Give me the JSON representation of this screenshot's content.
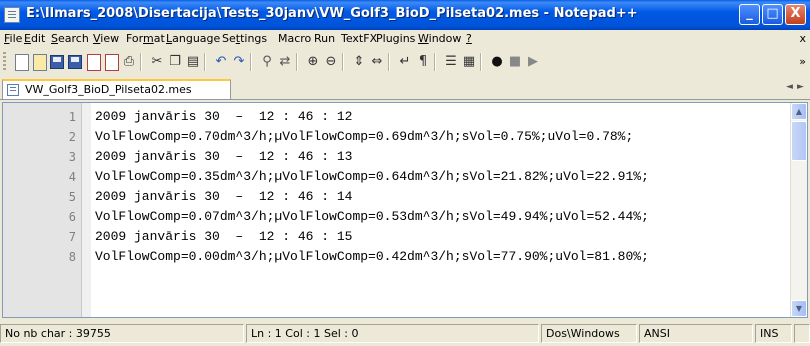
{
  "window": {
    "title": "E:\\Ilmars_2008\\Disertacija\\Tests_30janv\\VW_Golf3_BioD_Pilseta02.mes - Notepad++",
    "controls": {
      "minimize": "_",
      "maximize": "□",
      "close": "X"
    }
  },
  "menu": [
    {
      "label": "File",
      "mn": "F",
      "rest": "ile"
    },
    {
      "label": "Edit",
      "mn": "E",
      "rest": "dit"
    },
    {
      "label": "Search",
      "mn": "S",
      "rest": "earch"
    },
    {
      "label": "View",
      "mn": "V",
      "rest": "iew"
    },
    {
      "label": "Format",
      "pre": "For",
      "mn": "m",
      "rest": "at"
    },
    {
      "label": "Language",
      "mn": "L",
      "rest": "anguage"
    },
    {
      "label": "Settings",
      "pre": "Se",
      "mn": "t",
      "rest": "tings"
    },
    {
      "label": "Macro",
      "pre": "",
      "mn": "",
      "rest": "Macro"
    },
    {
      "label": "Run",
      "pre": "",
      "mn": "",
      "rest": "Run"
    },
    {
      "label": "TextFX",
      "pre": "",
      "mn": "",
      "rest": "TextFX"
    },
    {
      "label": "Plugins",
      "pre": "",
      "mn": "",
      "rest": "Plugins"
    },
    {
      "label": "Window",
      "mn": "W",
      "rest": "indow"
    },
    {
      "label": "?",
      "mn": "?",
      "rest": ""
    }
  ],
  "menu_close": "x",
  "toolbar": {
    "icons": [
      "new-file-icon",
      "open-file-icon",
      "save-icon",
      "save-all-icon",
      "close-icon",
      "close-all-icon",
      "print-icon",
      "cut-icon",
      "copy-icon",
      "paste-icon",
      "undo-icon",
      "redo-icon",
      "find-icon",
      "replace-icon",
      "zoom-in-icon",
      "zoom-out-icon",
      "sync-vertical-icon",
      "sync-horizontal-icon",
      "word-wrap-icon",
      "show-all-chars-icon",
      "indent-guide-icon",
      "user-lang-icon",
      "record-macro-icon",
      "stop-macro-icon",
      "play-macro-icon"
    ],
    "overflow": "»"
  },
  "tab": {
    "label": "VW_Golf3_BioD_Pilseta02.mes"
  },
  "tab_nav": {
    "prev": "◄",
    "next": "►"
  },
  "editor": {
    "lines": [
      {
        "n": "1",
        "text": "2009 janvāris 30  –  12 : 46 : 12"
      },
      {
        "n": "2",
        "text": "VolFlowComp=0.70dm^3/h;µVolFlowComp=0.69dm^3/h;sVol=0.75%;uVol=0.78%;"
      },
      {
        "n": "3",
        "text": "2009 janvāris 30  –  12 : 46 : 13"
      },
      {
        "n": "4",
        "text": "VolFlowComp=0.35dm^3/h;µVolFlowComp=0.64dm^3/h;sVol=21.82%;uVol=22.91%;"
      },
      {
        "n": "5",
        "text": "2009 janvāris 30  –  12 : 46 : 14"
      },
      {
        "n": "6",
        "text": "VolFlowComp=0.07dm^3/h;µVolFlowComp=0.53dm^3/h;sVol=49.94%;uVol=52.44%;"
      },
      {
        "n": "7",
        "text": "2009 janvāris 30  –  12 : 46 : 15"
      },
      {
        "n": "8",
        "text": "VolFlowComp=0.00dm^3/h;µVolFlowComp=0.42dm^3/h;sVol=77.90%;uVol=81.80%;"
      }
    ]
  },
  "scrollbar": {
    "up": "▲",
    "down": "▼"
  },
  "status": {
    "chars": "No nb char : 39755",
    "position": "Ln : 1   Col : 1   Sel : 0",
    "eol": "Dos\\Windows",
    "encoding": "ANSI",
    "mode": "INS"
  },
  "colors": {
    "titlebar": "#0054e3",
    "chrome": "#ece9d8",
    "gutter": "#e4e4e4",
    "active_tab_accent": "#ffc83c"
  }
}
